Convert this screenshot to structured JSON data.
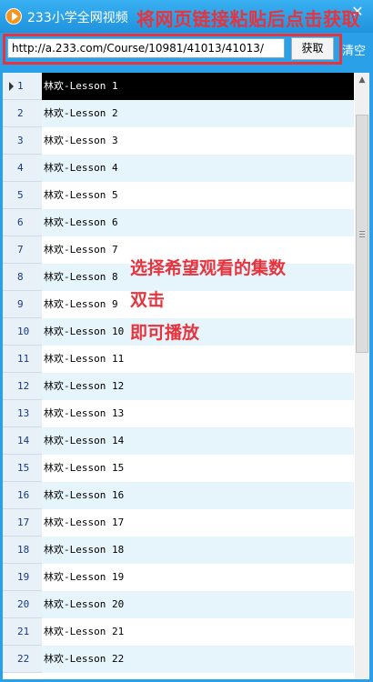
{
  "window": {
    "title": "233小学全网视频",
    "close_glyph": "✕"
  },
  "toolbar": {
    "url_value": "http://a.233.com/Course/10981/41013/41013/",
    "fetch_label": "获取",
    "clear_label": "清空"
  },
  "annotations": {
    "top": "将网页链接粘贴后点击获取",
    "line1": "选择希望观看的集数",
    "line2": "双击",
    "line3": "即可播放"
  },
  "lessons": [
    {
      "num": "1",
      "title": "林欢-Lesson 1"
    },
    {
      "num": "2",
      "title": "林欢-Lesson 2"
    },
    {
      "num": "3",
      "title": "林欢-Lesson 3"
    },
    {
      "num": "4",
      "title": "林欢-Lesson 4"
    },
    {
      "num": "5",
      "title": "林欢-Lesson 5"
    },
    {
      "num": "6",
      "title": "林欢-Lesson 6"
    },
    {
      "num": "7",
      "title": "林欢-Lesson 7"
    },
    {
      "num": "8",
      "title": "林欢-Lesson 8"
    },
    {
      "num": "9",
      "title": "林欢-Lesson 9"
    },
    {
      "num": "10",
      "title": "林欢-Lesson 10"
    },
    {
      "num": "11",
      "title": "林欢-Lesson 11"
    },
    {
      "num": "12",
      "title": "林欢-Lesson 12"
    },
    {
      "num": "13",
      "title": "林欢-Lesson 13"
    },
    {
      "num": "14",
      "title": "林欢-Lesson 14"
    },
    {
      "num": "15",
      "title": "林欢-Lesson 15"
    },
    {
      "num": "16",
      "title": "林欢-Lesson 16"
    },
    {
      "num": "17",
      "title": "林欢-Lesson 17"
    },
    {
      "num": "18",
      "title": "林欢-Lesson 18"
    },
    {
      "num": "19",
      "title": "林欢-Lesson 19"
    },
    {
      "num": "20",
      "title": "林欢-Lesson 20"
    },
    {
      "num": "21",
      "title": "林欢-Lesson 21"
    },
    {
      "num": "22",
      "title": "林欢-Lesson 22"
    }
  ],
  "colors": {
    "title_bar": "#2aa0e8",
    "annotation_red": "#e8333d",
    "selected_row": "#000000",
    "alt_row": "#e6f4fb"
  }
}
